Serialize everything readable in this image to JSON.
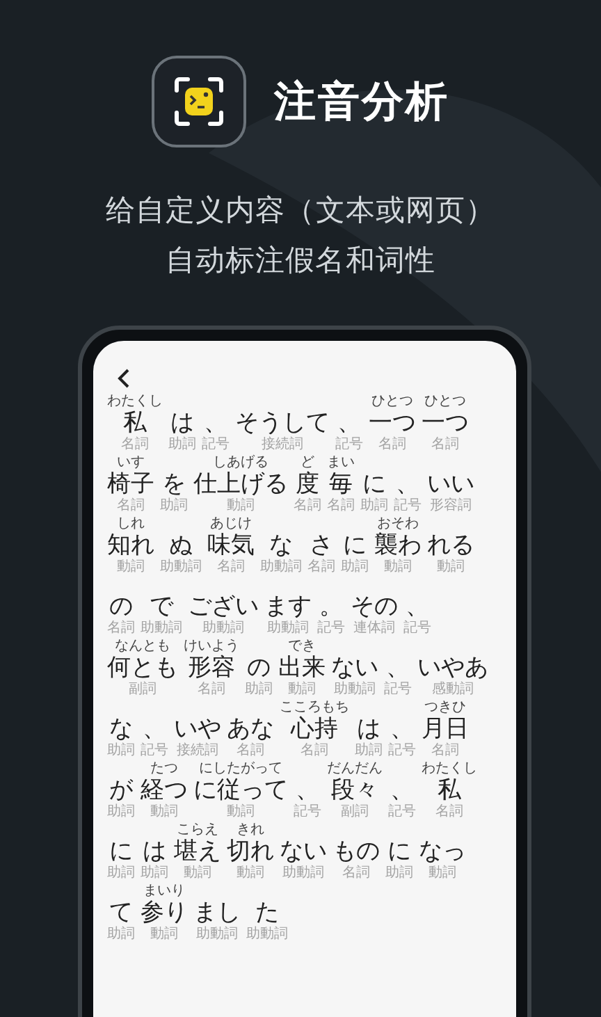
{
  "app": {
    "title": "注音分析"
  },
  "subtitle": [
    "给自定义内容（文本或网页）",
    "自动标注假名和词性"
  ],
  "lines": [
    [
      {
        "text": "私",
        "reading": "わたくし",
        "pos": "名詞"
      },
      {
        "text": "は",
        "pos": "助詞"
      },
      {
        "text": "、",
        "pos": "記号"
      },
      {
        "text": "そうして",
        "pos": "接続詞"
      },
      {
        "text": "、",
        "pos": "記号"
      },
      {
        "text": "一つ",
        "reading": "ひとつ",
        "pos": "名詞"
      },
      {
        "text": "一つ",
        "reading": "ひとつ",
        "pos": "名詞"
      }
    ],
    [
      {
        "text": "椅子",
        "reading": "いす",
        "pos": "名詞"
      },
      {
        "text": "を",
        "pos": "助詞"
      },
      {
        "text": "仕上げる",
        "reading": "しあげる",
        "pos": "動詞"
      },
      {
        "text": "度",
        "reading": "ど",
        "pos": "名詞"
      },
      {
        "text": "毎",
        "reading": "まい",
        "pos": "名詞"
      },
      {
        "text": "に",
        "pos": "助詞"
      },
      {
        "text": "、",
        "pos": "記号"
      },
      {
        "text": "いい",
        "pos": "形容詞"
      }
    ],
    [
      {
        "text": "知れ",
        "reading": "しれ",
        "pos": "動詞"
      },
      {
        "text": "ぬ",
        "pos": "助動詞"
      },
      {
        "text": "味気",
        "reading": "あじけ",
        "pos": "名詞"
      },
      {
        "text": "な",
        "pos": "助動詞"
      },
      {
        "text": "さ",
        "pos": "名詞"
      },
      {
        "text": "に",
        "pos": "助詞"
      },
      {
        "text": "襲わ",
        "reading": "おそわ",
        "pos": "動詞"
      },
      {
        "text": "れる",
        "pos": "動詞"
      }
    ],
    [
      {
        "text": "の",
        "pos": "名詞"
      },
      {
        "text": "で",
        "pos": "助動詞"
      },
      {
        "text": "ござい",
        "pos": "助動詞"
      },
      {
        "text": "ます",
        "pos": "助動詞"
      },
      {
        "text": "。",
        "pos": "記号"
      },
      {
        "text": "その",
        "pos": "連体詞"
      },
      {
        "text": "、",
        "pos": "記号"
      }
    ],
    [
      {
        "text": "何とも",
        "reading": "なんとも",
        "pos": "副詞"
      },
      {
        "text": "形容",
        "reading": "けいよう",
        "pos": "名詞"
      },
      {
        "text": "の",
        "pos": "助詞"
      },
      {
        "text": "出来",
        "reading": "でき",
        "pos": "動詞"
      },
      {
        "text": "ない",
        "pos": "助動詞"
      },
      {
        "text": "、",
        "pos": "記号"
      },
      {
        "text": "いやあ",
        "pos": "感動詞"
      }
    ],
    [
      {
        "text": "な",
        "pos": "助詞"
      },
      {
        "text": "、",
        "pos": "記号"
      },
      {
        "text": "いや",
        "pos": "接続詞"
      },
      {
        "text": "あな",
        "pos": "名詞"
      },
      {
        "text": "心持",
        "reading": "こころもち",
        "pos": "名詞"
      },
      {
        "text": "は",
        "pos": "助詞"
      },
      {
        "text": "、",
        "pos": "記号"
      },
      {
        "text": "月日",
        "reading": "つきひ",
        "pos": "名詞"
      }
    ],
    [
      {
        "text": "が",
        "pos": "助詞"
      },
      {
        "text": "経つ",
        "reading": "たつ",
        "pos": "動詞"
      },
      {
        "text": "に従って",
        "reading": "にしたがって",
        "pos": "動詞"
      },
      {
        "text": "、",
        "pos": "記号"
      },
      {
        "text": "段々",
        "reading": "だんだん",
        "pos": "副詞"
      },
      {
        "text": "、",
        "pos": "記号"
      },
      {
        "text": "私",
        "reading": "わたくし",
        "pos": "名詞"
      }
    ],
    [
      {
        "text": "に",
        "pos": "助詞"
      },
      {
        "text": "は",
        "pos": "助詞"
      },
      {
        "text": "堪え",
        "reading": "こらえ",
        "pos": "動詞"
      },
      {
        "text": "切れ",
        "reading": "きれ",
        "pos": "動詞"
      },
      {
        "text": "ない",
        "pos": "助動詞"
      },
      {
        "text": "もの",
        "pos": "名詞"
      },
      {
        "text": "に",
        "pos": "助詞"
      },
      {
        "text": "なっ",
        "pos": "動詞"
      }
    ],
    [
      {
        "text": "て",
        "pos": "助詞"
      },
      {
        "text": "参り",
        "reading": "まいり",
        "pos": "動詞"
      },
      {
        "text": "まし",
        "pos": "助動詞"
      },
      {
        "text": "た",
        "pos": "助動詞"
      }
    ]
  ]
}
